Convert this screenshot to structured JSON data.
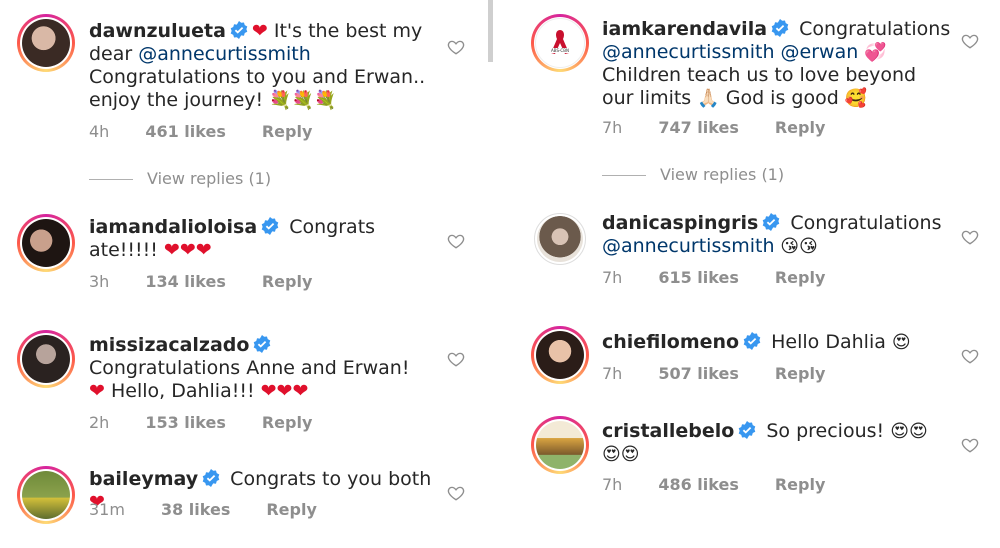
{
  "left": [
    {
      "username": "dawnzulueta",
      "parts": [
        {
          "t": "heart",
          "v": "❤"
        },
        {
          "t": "text",
          "v": " It's the best my dear "
        },
        {
          "t": "mention",
          "v": "@annecurtissmith"
        },
        {
          "t": "text",
          "v": " Congratulations to you and Erwan.. enjoy the journey! "
        },
        {
          "t": "emoji",
          "v": "💐💐💐"
        }
      ],
      "time": "4h",
      "likes": "461 likes",
      "reply": "Reply",
      "view_replies": "View replies (1)"
    },
    {
      "username": "iamandalioloisa",
      "parts": [
        {
          "t": "text",
          "v": " Congrats ate!!!!! "
        },
        {
          "t": "heart",
          "v": "❤❤❤"
        }
      ],
      "time": "3h",
      "likes": "134 likes",
      "reply": "Reply"
    },
    {
      "username": "missizacalzado",
      "parts": [
        {
          "t": "text",
          "v": " Congratulations Anne and Erwan! "
        },
        {
          "t": "heart",
          "v": "❤"
        },
        {
          "t": "text",
          "v": " Hello, Dahlia!!! "
        },
        {
          "t": "heart",
          "v": "❤❤❤"
        }
      ],
      "time": "2h",
      "likes": "153 likes",
      "reply": "Reply"
    },
    {
      "username": "baileymay",
      "parts": [
        {
          "t": "text",
          "v": " Congrats to you both "
        },
        {
          "t": "heart",
          "v": "❤"
        }
      ],
      "time": "31m",
      "likes": "38 likes",
      "reply": "Reply"
    }
  ],
  "right": [
    {
      "username": "iamkarendavila",
      "parts": [
        {
          "t": "text",
          "v": " Congratulations "
        },
        {
          "t": "mention",
          "v": "@annecurtissmith @erwan"
        },
        {
          "t": "emoji",
          "v": " 💞 "
        },
        {
          "t": "text",
          "v": "Children teach us to love beyond our limits "
        },
        {
          "t": "emoji",
          "v": "🙏🏻"
        },
        {
          "t": "text",
          "v": " God is good "
        },
        {
          "t": "emoji",
          "v": "🥰"
        }
      ],
      "time": "7h",
      "likes": "747 likes",
      "reply": "Reply",
      "view_replies": "View replies (1)"
    },
    {
      "username": "danicaspingris",
      "parts": [
        {
          "t": "text",
          "v": " Congratulations "
        },
        {
          "t": "mention",
          "v": "@annecurtissmith"
        },
        {
          "t": "emoji",
          "v": " 😘😘"
        }
      ],
      "time": "7h",
      "likes": "615 likes",
      "reply": "Reply"
    },
    {
      "username": "chiefilomeno",
      "parts": [
        {
          "t": "text",
          "v": " Hello Dahlia "
        },
        {
          "t": "emoji",
          "v": "😍"
        }
      ],
      "time": "7h",
      "likes": "507 likes",
      "reply": "Reply"
    },
    {
      "username": "cristallebelo",
      "parts": [
        {
          "t": "text",
          "v": " So precious! "
        },
        {
          "t": "emoji",
          "v": "😍😍😍😍"
        }
      ],
      "time": "7h",
      "likes": "486 likes",
      "reply": "Reply"
    }
  ],
  "icons": {
    "verified": "verified-badge-icon",
    "like": "heart-outline-icon"
  },
  "colors": {
    "verified": "#3897f0",
    "heart": "#e0102c",
    "mention": "#00376b",
    "meta": "#8e8e8e"
  }
}
